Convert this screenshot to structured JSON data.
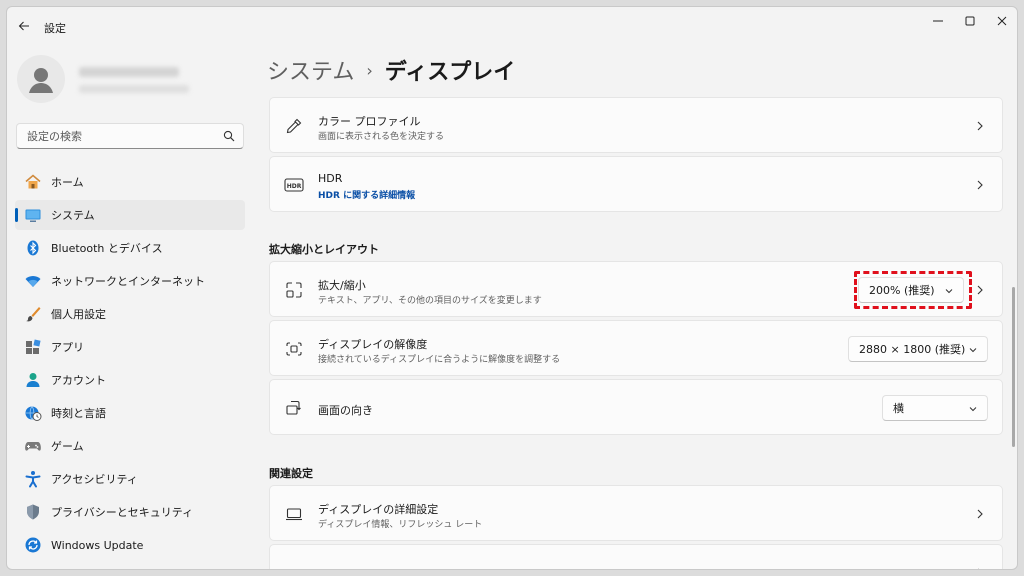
{
  "app": {
    "title": "設定"
  },
  "sidebar": {
    "search_placeholder": "設定の検索",
    "items": [
      {
        "label": "ホーム",
        "icon": "home-icon",
        "active": false
      },
      {
        "label": "システム",
        "icon": "system-icon",
        "active": true
      },
      {
        "label": "Bluetooth とデバイス",
        "icon": "bluetooth-icon",
        "active": false
      },
      {
        "label": "ネットワークとインターネット",
        "icon": "wifi-icon",
        "active": false
      },
      {
        "label": "個人用設定",
        "icon": "brush-icon",
        "active": false
      },
      {
        "label": "アプリ",
        "icon": "apps-icon",
        "active": false
      },
      {
        "label": "アカウント",
        "icon": "account-icon",
        "active": false
      },
      {
        "label": "時刻と言語",
        "icon": "globe-clock-icon",
        "active": false
      },
      {
        "label": "ゲーム",
        "icon": "gamepad-icon",
        "active": false
      },
      {
        "label": "アクセシビリティ",
        "icon": "accessibility-icon",
        "active": false
      },
      {
        "label": "プライバシーとセキュリティ",
        "icon": "shield-icon",
        "active": false
      },
      {
        "label": "Windows Update",
        "icon": "update-icon",
        "active": false
      }
    ]
  },
  "breadcrumb": {
    "parent": "システム",
    "separator": "›",
    "current": "ディスプレイ"
  },
  "cards": {
    "color_profile": {
      "title": "カラー プロファイル",
      "subtitle": "画面に表示される色を決定する"
    },
    "hdr": {
      "title": "HDR",
      "link": "HDR に関する詳細情報"
    },
    "scale": {
      "title": "拡大/縮小",
      "subtitle": "テキスト、アプリ、その他の項目のサイズを変更します",
      "value": "200% (推奨)"
    },
    "resolution": {
      "title": "ディスプレイの解像度",
      "subtitle": "接続されているディスプレイに合うように解像度を調整する",
      "value": "2880 × 1800 (推奨)"
    },
    "orientation": {
      "title": "画面の向き",
      "value": "横"
    },
    "advanced": {
      "title": "ディスプレイの詳細設定",
      "subtitle": "ディスプレイ情報、リフレッシュ レート"
    }
  },
  "sections": {
    "scale_layout": "拡大縮小とレイアウト",
    "related": "関連設定"
  },
  "colors": {
    "accent": "#005fb8",
    "link": "#0a4fa6",
    "highlight": "#e0101c"
  }
}
